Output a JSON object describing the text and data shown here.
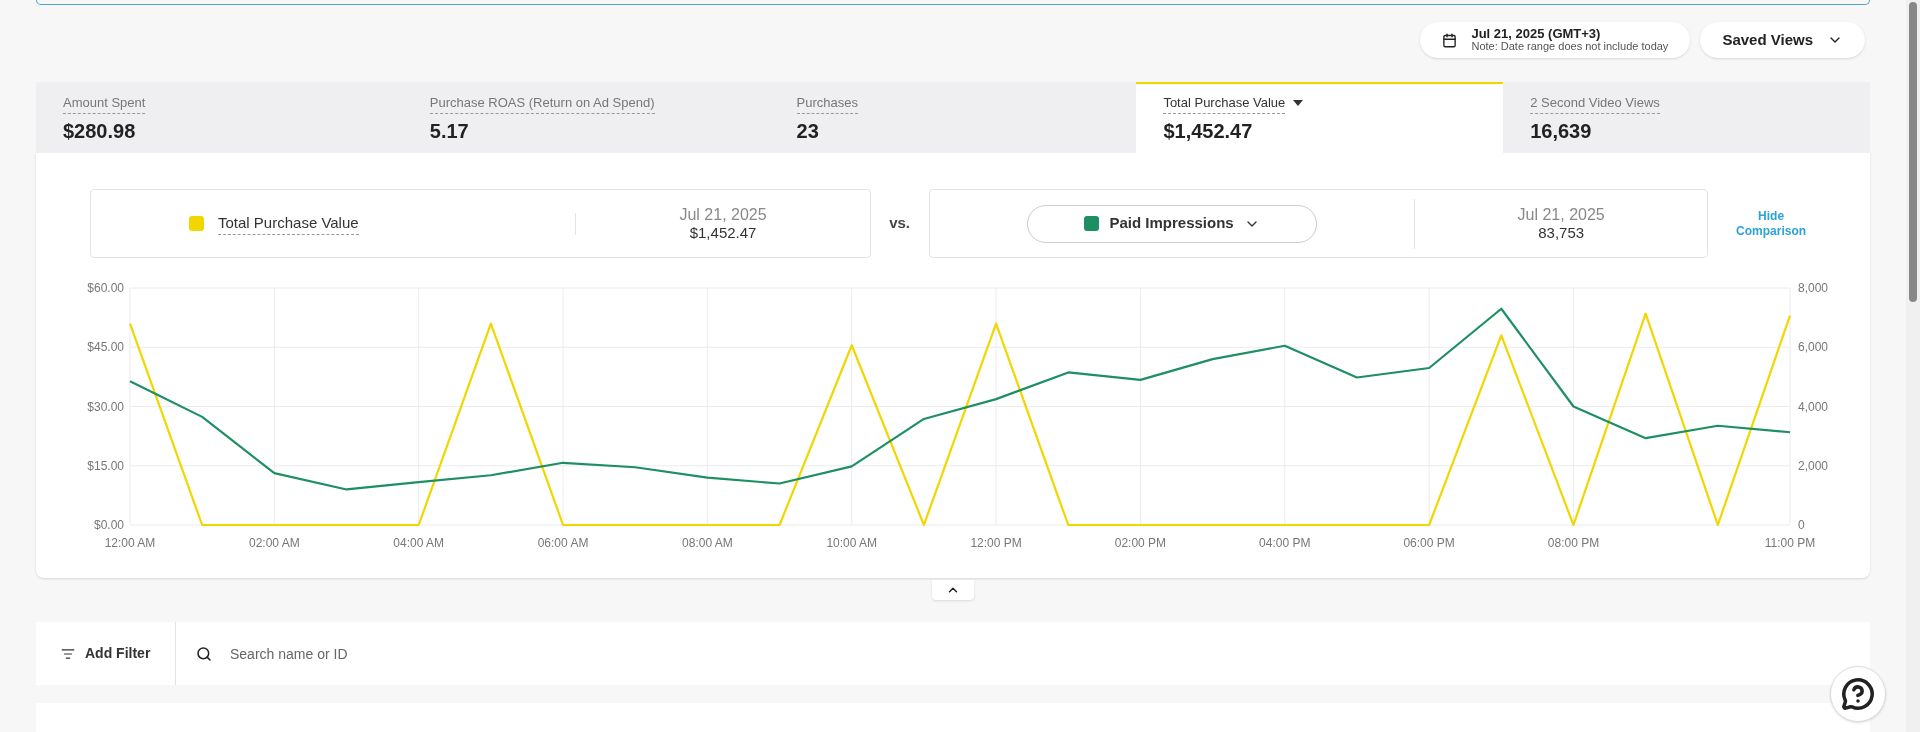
{
  "date_picker": {
    "date": "Jul 21, 2025 (GMT+3)",
    "note": "Note: Date range does not include today"
  },
  "saved_views": {
    "label": "Saved Views"
  },
  "metric_tabs": [
    {
      "label": "Amount Spent",
      "value": "$280.98",
      "selected": false,
      "dropdown": false
    },
    {
      "label": "Purchase ROAS (Return on Ad Spend)",
      "value": "5.17",
      "selected": false,
      "dropdown": false
    },
    {
      "label": "Purchases",
      "value": "23",
      "selected": false,
      "dropdown": false
    },
    {
      "label": "Total Purchase Value",
      "value": "$1,452.47",
      "selected": true,
      "dropdown": true
    },
    {
      "label": "2 Second Video Views",
      "value": "16,639",
      "selected": false,
      "dropdown": false
    }
  ],
  "comparison": {
    "primary": {
      "date": "Jul 21, 2025",
      "value": "$1,452.47"
    },
    "vs": "vs.",
    "secondary": {
      "date": "Jul 21, 2025",
      "value": "83,753"
    },
    "hide_button": "Hide Comparison"
  },
  "chart_data": {
    "type": "line",
    "x": [
      0,
      1,
      2,
      3,
      4,
      5,
      6,
      7,
      8,
      9,
      10,
      11,
      12,
      13,
      14,
      15,
      16,
      17,
      18,
      19,
      20,
      21,
      22,
      23
    ],
    "xticks": [
      {
        "value": 0,
        "label": "12:00 AM"
      },
      {
        "value": 2,
        "label": "02:00 AM"
      },
      {
        "value": 4,
        "label": "04:00 AM"
      },
      {
        "value": 6,
        "label": "06:00 AM"
      },
      {
        "value": 8,
        "label": "08:00 AM"
      },
      {
        "value": 10,
        "label": "10:00 AM"
      },
      {
        "value": 12,
        "label": "12:00 PM"
      },
      {
        "value": 14,
        "label": "02:00 PM"
      },
      {
        "value": 16,
        "label": "04:00 PM"
      },
      {
        "value": 18,
        "label": "06:00 PM"
      },
      {
        "value": 20,
        "label": "08:00 PM"
      },
      {
        "value": 23,
        "label": "11:00 PM"
      }
    ],
    "xlim": [
      0,
      23
    ],
    "grid": true,
    "ylim": [
      0,
      60
    ],
    "yticks": [
      {
        "value": 0,
        "label": "$0.00"
      },
      {
        "value": 15,
        "label": "$15.00"
      },
      {
        "value": 30,
        "label": "$30.00"
      },
      {
        "value": 45,
        "label": "$45.00"
      },
      {
        "value": 60,
        "label": "$60.00"
      }
    ],
    "y2lim": [
      0,
      8000
    ],
    "y2ticks": [
      {
        "value": 0,
        "label": "0"
      },
      {
        "value": 2000,
        "label": "2,000"
      },
      {
        "value": 4000,
        "label": "4,000"
      },
      {
        "value": 6000,
        "label": "6,000"
      },
      {
        "value": 8000,
        "label": "8,000"
      }
    ],
    "series": [
      {
        "name": "Total Purchase Value",
        "color": "#f2d600",
        "values": [
          51,
          0,
          0,
          0,
          0,
          51,
          0,
          0,
          0,
          0,
          45.5,
          0,
          51,
          0,
          0,
          0,
          0,
          0,
          0,
          48,
          0,
          53.5,
          0,
          53
        ]
      },
      {
        "name": "Paid Impressions",
        "color": "#1e8f63",
        "axis": "y2",
        "values": [
          4850,
          3650,
          1750,
          1200,
          1450,
          1680,
          2100,
          1950,
          1600,
          1400,
          1980,
          3580,
          4250,
          5150,
          4900,
          5600,
          6050,
          4980,
          5300,
          7300,
          4000,
          2930,
          3350,
          3130
        ]
      }
    ]
  },
  "filter_bar": {
    "add_filter": "Add Filter",
    "search": {
      "placeholder": "Search name or ID"
    }
  }
}
